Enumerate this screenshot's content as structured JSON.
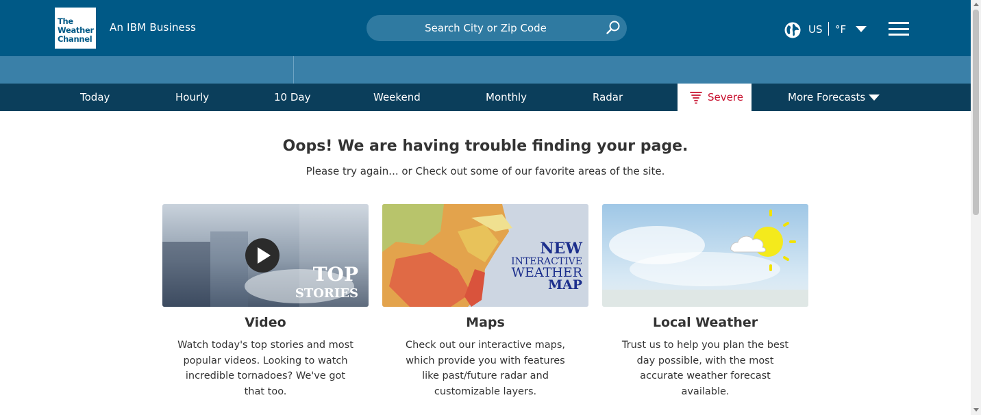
{
  "header": {
    "logo_lines": [
      "The",
      "Weather",
      "Channel"
    ],
    "tagline_prefix": "An",
    "tagline_brand": "IBM Business",
    "search_placeholder": "Search City or Zip Code",
    "region": "US",
    "unit": "°F",
    "icons": [
      "search-icon",
      "globe-icon",
      "caret-down-icon",
      "menu-icon"
    ]
  },
  "nav": {
    "items": [
      {
        "label": "Today"
      },
      {
        "label": "Hourly"
      },
      {
        "label": "10 Day"
      },
      {
        "label": "Weekend"
      },
      {
        "label": "Monthly"
      },
      {
        "label": "Radar"
      },
      {
        "label": "Severe",
        "active": true,
        "color": "#c8102e"
      },
      {
        "label": "More Forecasts"
      }
    ]
  },
  "main": {
    "heading": "Oops! We are having trouble finding your page.",
    "subheading": "Please try again... or Check out some of our favorite areas of the site.",
    "cards": [
      {
        "title": "Video",
        "description": "Watch today's top stories and most popular videos. Looking to watch incredible tornadoes? We've got that too.",
        "image_text": [
          "TOP",
          "STORIES"
        ]
      },
      {
        "title": "Maps",
        "description": "Check out our interactive maps, which provide you with features like past/future radar and customizable layers.",
        "image_text": [
          "NEW",
          "INTERACTIVE",
          "WEATHER",
          "MAP"
        ]
      },
      {
        "title": "Local Weather",
        "description": "Trust us to help you plan the best day possible, with the most accurate weather forecast available."
      }
    ]
  },
  "colors": {
    "header": "#005986",
    "subbar": "#3a80a8",
    "nav": "#0b3e5b",
    "severe": "#c8102e"
  }
}
